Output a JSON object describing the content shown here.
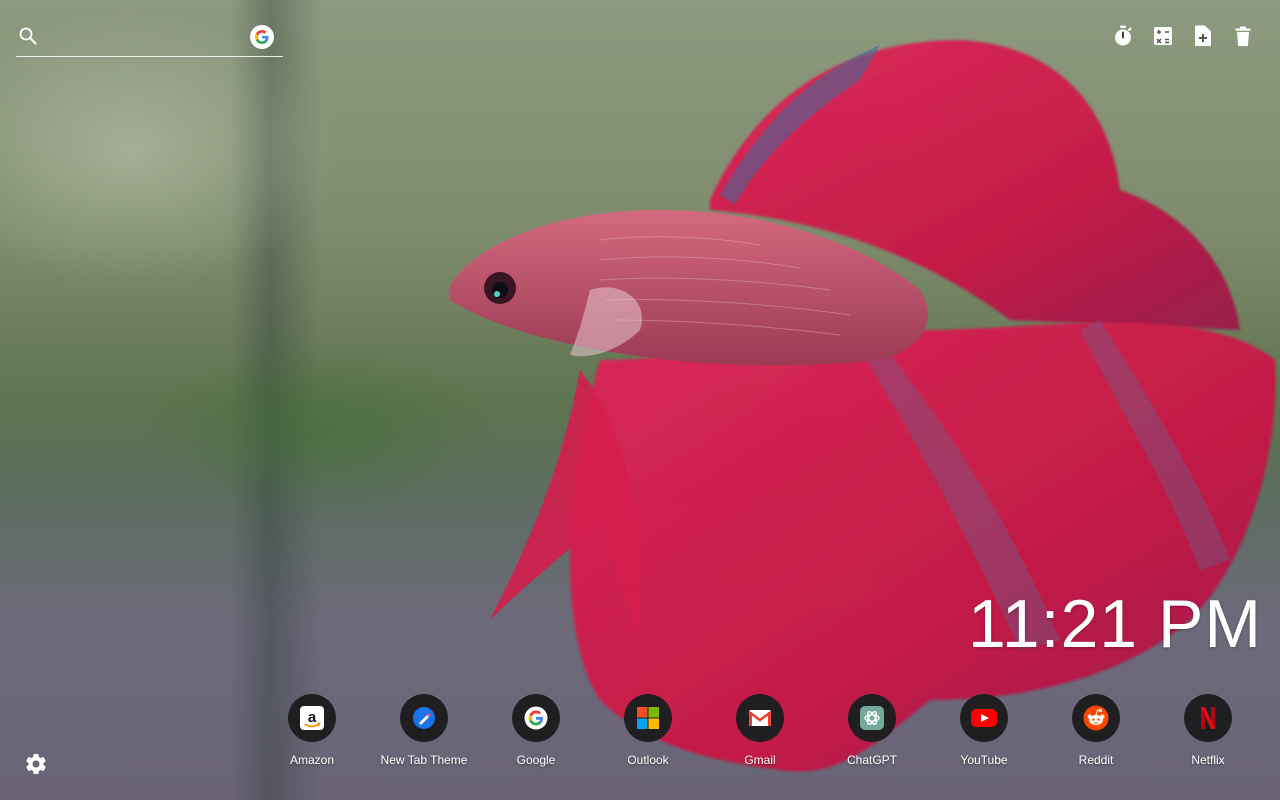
{
  "search": {
    "placeholder": "",
    "value": ""
  },
  "toolbar": {
    "buttons": [
      {
        "icon": "timer-icon"
      },
      {
        "icon": "calculator-icon"
      },
      {
        "icon": "add-note-icon"
      },
      {
        "icon": "trash-icon"
      }
    ]
  },
  "clock": {
    "time": "11:21 PM"
  },
  "shortcuts": [
    {
      "label": "Amazon",
      "icon": "amazon-icon"
    },
    {
      "label": "New Tab Theme",
      "icon": "new-tab-theme-icon"
    },
    {
      "label": "Google",
      "icon": "google-icon"
    },
    {
      "label": "Outlook",
      "icon": "microsoft-icon"
    },
    {
      "label": "Gmail",
      "icon": "gmail-icon"
    },
    {
      "label": "ChatGPT",
      "icon": "chatgpt-icon"
    },
    {
      "label": "YouTube",
      "icon": "youtube-icon"
    },
    {
      "label": "Reddit",
      "icon": "reddit-icon"
    },
    {
      "label": "Netflix",
      "icon": "netflix-icon"
    }
  ],
  "colors": {
    "fish_red": "#d81b4a",
    "shortcut_bg": "#1f1f22",
    "text": "#ffffff"
  }
}
